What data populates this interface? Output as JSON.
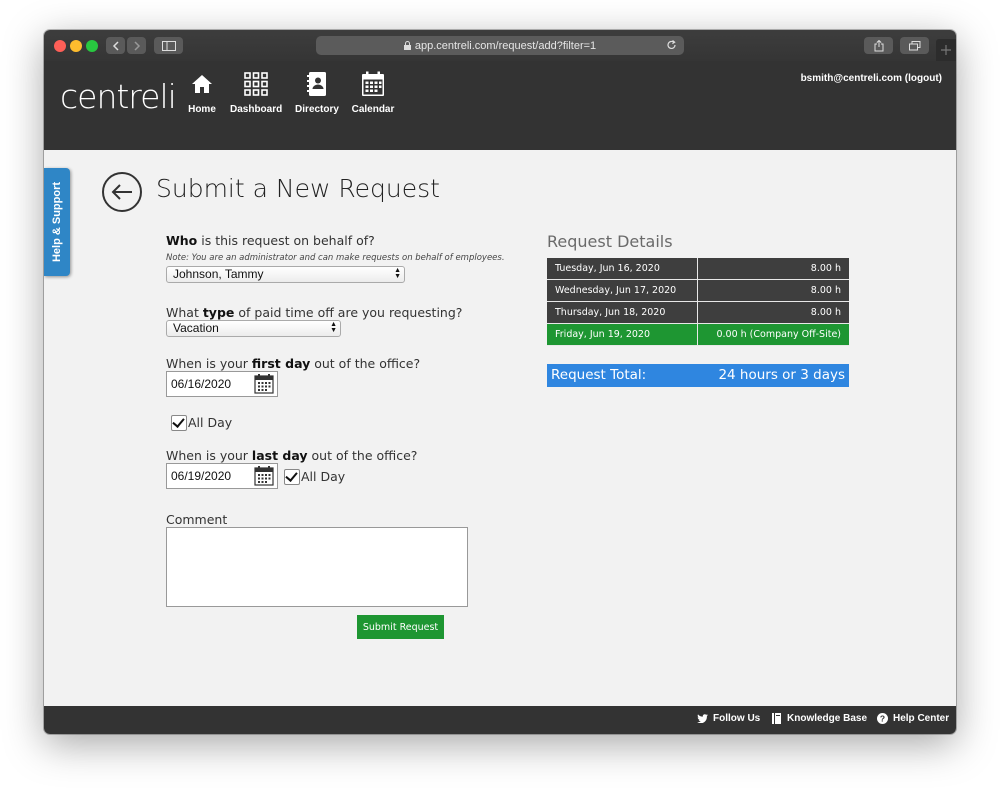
{
  "browser": {
    "url": "app.centreli.com/request/add?filter=1"
  },
  "header": {
    "logo": "centreli",
    "nav": [
      {
        "label": "Home",
        "icon": "home-icon"
      },
      {
        "label": "Dashboard",
        "icon": "dashboard-icon"
      },
      {
        "label": "Directory",
        "icon": "directory-icon"
      },
      {
        "label": "Calendar",
        "icon": "calendar-icon"
      }
    ],
    "user": "bsmith@centreli.com (logout)"
  },
  "help_tab": "Help & Support",
  "page": {
    "title": "Submit a New Request"
  },
  "form": {
    "who_bold": "Who",
    "who_rest": " is this request on behalf of?",
    "note": "Note: You are an administrator and can make requests on behalf of employees.",
    "who_value": "Johnson, Tammy",
    "type_pre": "What ",
    "type_bold": "type",
    "type_post": " of paid time off are you requesting?",
    "type_value": "Vacation",
    "first_pre": "When is your ",
    "first_bold": "first day",
    "first_post": " out of the office?",
    "first_date": "06/16/2020",
    "first_allday": "All Day",
    "last_pre": "When is your ",
    "last_bold": "last day",
    "last_post": " out of the office?",
    "last_date": "06/19/2020",
    "last_allday": "All Day",
    "comment_label": "Comment",
    "comment_value": "",
    "submit": "Submit Request"
  },
  "details": {
    "title": "Request Details",
    "rows": [
      {
        "day": "Tuesday, Jun 16, 2020",
        "hours": "8.00 h"
      },
      {
        "day": "Wednesday, Jun 17, 2020",
        "hours": "8.00 h"
      },
      {
        "day": "Thursday, Jun 18, 2020",
        "hours": "8.00 h"
      },
      {
        "day": "Friday, Jun 19, 2020",
        "hours": "0.00 h (Company Off-Site)"
      }
    ],
    "total_label": "Request Total:",
    "total_value": "24 hours or 3 days"
  },
  "footer": {
    "follow": "Follow Us",
    "kb": "Knowledge Base",
    "help": "Help Center"
  },
  "colors": {
    "header_bg": "#333333",
    "accent_blue": "#2f86e0",
    "accent_green": "#1e9632"
  }
}
